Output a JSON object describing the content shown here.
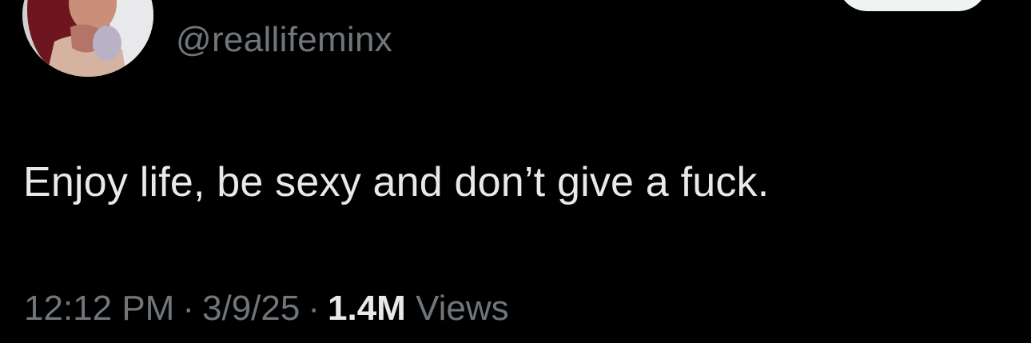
{
  "tweet": {
    "handle": "@reallifeminx",
    "text": "Enjoy life, be sexy and don’t give a fuck.",
    "time": "12:12 PM",
    "separator": "·",
    "date": "3/9/25",
    "views_count": "1.4M",
    "views_label": "Views"
  },
  "colors": {
    "background": "#000000",
    "primary_text": "#e7e9ea",
    "secondary_text": "#71767b",
    "button": "#eff3f4"
  }
}
